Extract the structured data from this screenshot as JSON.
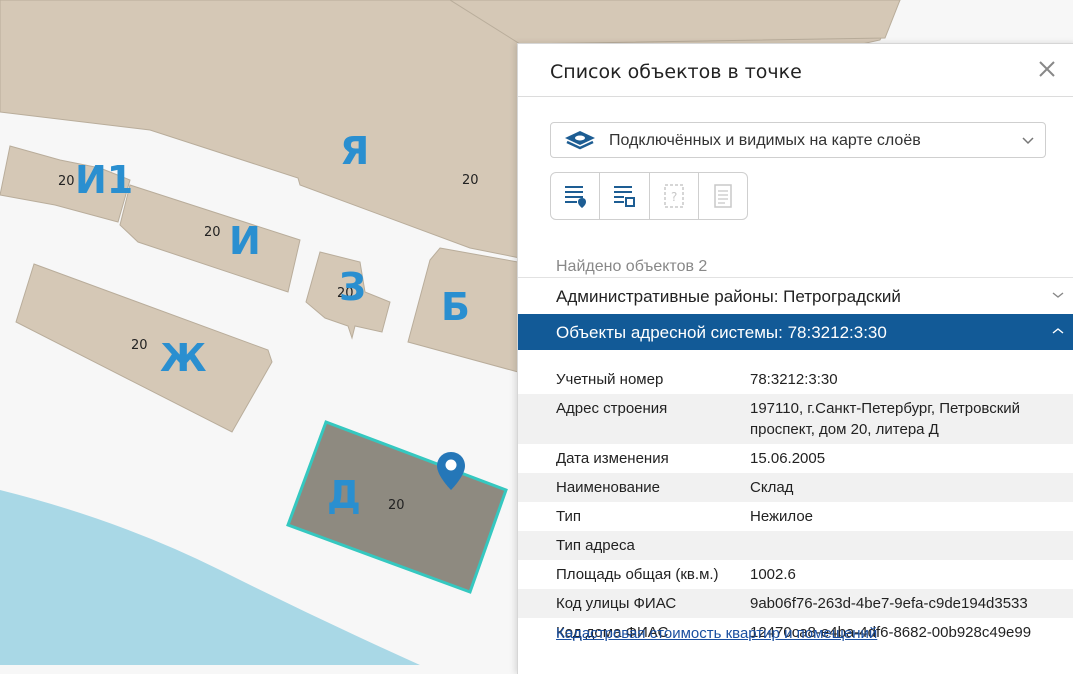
{
  "map": {
    "buildings": [
      {
        "id": "ya",
        "letter": "Я",
        "number": "20"
      },
      {
        "id": "i1",
        "letter": "И1",
        "number": "20"
      },
      {
        "id": "i",
        "letter": "И",
        "number": "20"
      },
      {
        "id": "z",
        "letter": "З",
        "number": "20"
      },
      {
        "id": "b",
        "letter": "Б",
        "number": ""
      },
      {
        "id": "zh",
        "letter": "Ж",
        "number": "20"
      },
      {
        "id": "d",
        "letter": "Д",
        "number": "20",
        "selected": true
      }
    ],
    "colors": {
      "background": "#f7f7f7",
      "building_fill": "#d5c8b6",
      "building_stroke": "#b9ad9b",
      "selected_fill": "#8e8a80",
      "selected_stroke": "#35c8c0",
      "water": "#a9d8e6",
      "letters": "#2a8fd0",
      "marker": "#2577b8"
    }
  },
  "panel": {
    "title": "Список объектов в точке",
    "layer_select": {
      "value": "Подключённых и видимых на карте слоёв",
      "icon": "layers-icon"
    },
    "toolbar": [
      "list-marker-icon",
      "list-area-icon",
      "unknown-object-icon",
      "document-icon"
    ],
    "found_text": "Найдено объектов 2",
    "accordion": [
      {
        "label": "Административные районы: Петроградский",
        "expanded": false
      },
      {
        "label": "Объекты адресной системы: 78:3212:3:30",
        "expanded": true
      }
    ],
    "attributes": [
      {
        "key": "Учетный номер",
        "value": "78:3212:3:30"
      },
      {
        "key": "Адрес строения",
        "value": "197110, г.Санкт-Петербург, Петровский проспект, дом 20, литера Д"
      },
      {
        "key": "Дата изменения",
        "value": "15.06.2005"
      },
      {
        "key": "Наименование",
        "value": "Склад"
      },
      {
        "key": "Тип",
        "value": "Нежилое"
      },
      {
        "key": "Тип адреса",
        "value": ""
      },
      {
        "key": "Площадь общая (кв.м.)",
        "value": "1002.6"
      },
      {
        "key": "Код улицы ФИАС",
        "value": "9ab06f76-263d-4be7-9efa-c9de194d3533"
      },
      {
        "key": "Код дома ФИАС",
        "value": "12470ca8-e4ba-4df6-8682-00b928c49e99"
      }
    ],
    "link": "Кадастровая стоимость квартир и помещений"
  }
}
